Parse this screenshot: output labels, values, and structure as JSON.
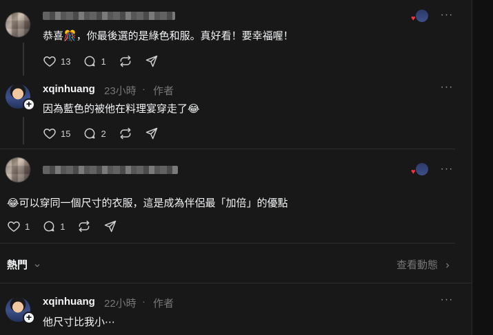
{
  "reply1": {
    "text": "恭喜🎊，你最後選的是綠色和服。真好看！要幸福喔！",
    "likes": "13",
    "replies": "1"
  },
  "reply2": {
    "username": "xqinhuang",
    "time": "23小時",
    "badge": "作者",
    "text": "因為藍色的被他在料理宴穿走了😂",
    "likes": "15",
    "replies": "2"
  },
  "reply3": {
    "text": "😂可以穿同一個尺寸的衣服，這是成為伴侶最「加倍」的優點",
    "likes": "1",
    "replies": "1"
  },
  "section": {
    "title": "熱門",
    "link": "查看動態"
  },
  "reply4": {
    "username": "xqinhuang",
    "time": "22小時",
    "badge": "作者",
    "text": "他尺寸比我小⋯"
  },
  "separator_dot": "·",
  "icons": {
    "like": "heart-icon",
    "reply": "comment-icon",
    "repost": "repost-icon",
    "share": "send-icon",
    "more": "more-icon",
    "chevron": "chevron-icon"
  }
}
